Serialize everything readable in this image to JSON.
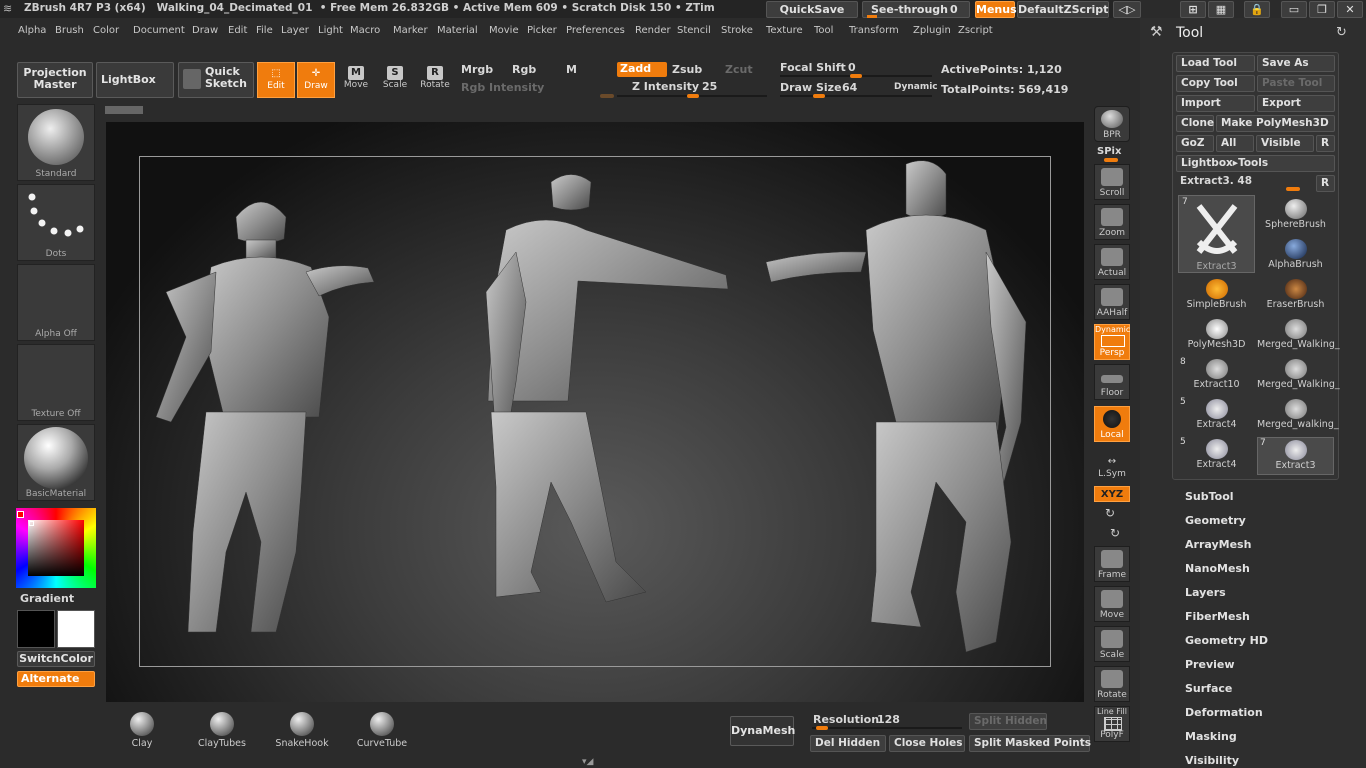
{
  "title_bar": {
    "app": "ZBrush 4R7 P3 (x64)",
    "document": "Walking_04_Decimated_01",
    "free_mem": "Free Mem 26.832GB",
    "active_mem": "Active Mem 609",
    "scratch_disk": "Scratch Disk 150",
    "ztime": "ZTim",
    "quicksave": "QuickSave",
    "see_through": "See-through",
    "see_through_value": "0",
    "menus": "Menus",
    "default_zscript": "DefaultZScript"
  },
  "menu_bar": [
    "Alpha",
    "Brush",
    "Color",
    "Document",
    "Draw",
    "Edit",
    "File",
    "Layer",
    "Light",
    "Macro",
    "Marker",
    "Material",
    "Movie",
    "Picker",
    "Preferences",
    "Render",
    "Stencil",
    "Stroke",
    "Texture",
    "Tool",
    "Transform",
    "Zplugin",
    "Zscript"
  ],
  "shelf": {
    "projection_master": "Projection Master",
    "lightbox": "LightBox",
    "quick_sketch": "Quick Sketch",
    "edit": "Edit",
    "draw": "Draw",
    "move": "Move",
    "scale": "Scale",
    "rotate": "Rotate",
    "mrgb": "Mrgb",
    "rgb": "Rgb",
    "m": "M",
    "rgb_intensity": "Rgb Intensity",
    "zadd": "Zadd",
    "zsub": "Zsub",
    "zcut": "Zcut",
    "z_intensity_label": "Z Intensity",
    "z_intensity_value": "25",
    "focal_shift_label": "Focal Shift",
    "focal_shift_value": "0",
    "draw_size_label": "Draw Size",
    "draw_size_value": "64",
    "dynamic": "Dynamic",
    "active_points": "ActivePoints: 1,120",
    "total_points": "TotalPoints: 569,419"
  },
  "left_panel": {
    "brush": "Standard",
    "stroke": "Dots",
    "alpha": "Alpha  Off",
    "texture": "Texture  Off",
    "material": "BasicMaterial",
    "gradient": "Gradient",
    "switch_color": "SwitchColor",
    "alternate": "Alternate"
  },
  "right_toolbar": {
    "bpr": "BPR",
    "spix": "SPix",
    "scroll": "Scroll",
    "zoom": "Zoom",
    "actual": "Actual",
    "aahalf": "AAHalf",
    "dynamic": "Dynamic",
    "persp": "Persp",
    "floor": "Floor",
    "local": "Local",
    "lsym": "L.Sym",
    "xyz": "XYZ",
    "frame": "Frame",
    "move": "Move",
    "scale": "Scale",
    "rotate": "Rotate",
    "line_fill": "Line Fill",
    "polyf": "PolyF"
  },
  "tool_panel": {
    "title": "Tool",
    "load_tool": "Load Tool",
    "save_as": "Save As",
    "copy_tool": "Copy Tool",
    "paste_tool": "Paste Tool",
    "import": "Import",
    "export": "Export",
    "clone": "Clone",
    "make_polymesh": "Make PolyMesh3D",
    "goz": "GoZ",
    "all": "All",
    "visible": "Visible",
    "r": "R",
    "lightbox_tools": "Lightbox▸Tools",
    "current_tool": "Extract3. 48",
    "current_thumb_label": "Extract3",
    "current_thumb_num": "7",
    "thumbs": [
      {
        "label": "SphereBrush",
        "num": ""
      },
      {
        "label": "AlphaBrush",
        "num": ""
      },
      {
        "label": "SimpleBrush",
        "num": ""
      },
      {
        "label": "EraserBrush",
        "num": ""
      },
      {
        "label": "PolyMesh3D",
        "num": ""
      },
      {
        "label": "Merged_Walking_",
        "num": ""
      },
      {
        "label": "Extract10",
        "num": "8"
      },
      {
        "label": "Merged_Walking_",
        "num": ""
      },
      {
        "label": "Extract4",
        "num": "5"
      },
      {
        "label": "Merged_walking_",
        "num": ""
      },
      {
        "label": "Extract4",
        "num": "5"
      },
      {
        "label": "Extract3",
        "num": "7"
      }
    ],
    "sections": [
      "SubTool",
      "Geometry",
      "ArrayMesh",
      "NanoMesh",
      "Layers",
      "FiberMesh",
      "Geometry HD",
      "Preview",
      "Surface",
      "Deformation",
      "Masking",
      "Visibility"
    ]
  },
  "bottom_shelf": {
    "brushes": [
      "Clay",
      "ClayTubes",
      "SnakeHook",
      "CurveTube"
    ],
    "dynamesh": "DynaMesh",
    "resolution_label": "Resolution",
    "resolution_value": "128",
    "split_hidden": "Split Hidden",
    "del_hidden": "Del Hidden",
    "close_holes": "Close Holes",
    "split_masked_points": "Split Masked Points"
  },
  "colors": {
    "accent": "#f07c0d",
    "panel": "#2e2e2e",
    "button": "#3e3e3e"
  }
}
